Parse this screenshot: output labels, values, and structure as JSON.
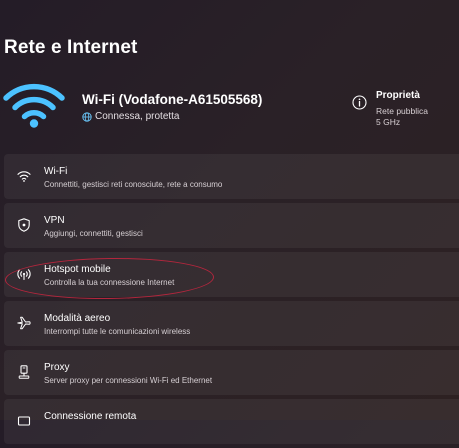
{
  "page": {
    "title": "Rete e Internet"
  },
  "connection": {
    "network_name": "Wi-Fi (Vodafone-A61505568)",
    "status": "Connessa, protetta"
  },
  "properties": {
    "title": "Proprietà",
    "network_type": "Rete pubblica",
    "band": "5 GHz"
  },
  "items": [
    {
      "label": "Wi-Fi",
      "desc": "Connettiti, gestisci reti conosciute, rete a consumo",
      "icon": "wifi-icon"
    },
    {
      "label": "VPN",
      "desc": "Aggiungi, connettiti, gestisci",
      "icon": "shield-icon"
    },
    {
      "label": "Hotspot mobile",
      "desc": "Controlla la tua connessione Internet",
      "icon": "hotspot-icon"
    },
    {
      "label": "Modalità aereo",
      "desc": "Interrompi tutte le comunicazioni wireless",
      "icon": "airplane-icon"
    },
    {
      "label": "Proxy",
      "desc": "Server proxy per connessioni Wi-Fi ed Ethernet",
      "icon": "proxy-icon"
    },
    {
      "label": "Connessione remota",
      "desc": "",
      "icon": "dialup-icon"
    }
  ],
  "colors": {
    "accent": "#4cc2ff",
    "annotation": "#b3263d",
    "background": "#2a2127"
  }
}
